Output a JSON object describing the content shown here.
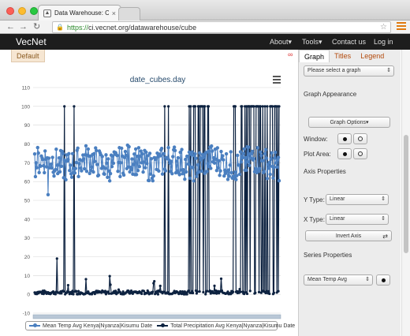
{
  "browser": {
    "tab_title": "Data Warehouse: Cube Br",
    "url_scheme": "https://",
    "url_rest": "ci.vecnet.org/datawarehouse/cube"
  },
  "nav": {
    "brand": "VecNet",
    "links": [
      "About▾",
      "Tools▾",
      "Contact us",
      "Log in"
    ]
  },
  "strip": {
    "default_tab": "Default"
  },
  "chart_data": {
    "type": "line",
    "title": "date_cubes.day",
    "ylim": [
      -10,
      110
    ],
    "yticks": [
      -10,
      0,
      10,
      20,
      30,
      40,
      50,
      60,
      70,
      80,
      90,
      100,
      110
    ],
    "series": [
      {
        "name": "Mean Temp Avg Kenya|Nyanza|Kisumu Date",
        "color": "#4a7fc0",
        "band": [
          63,
          85
        ]
      },
      {
        "name": "Total Precipitation Avg Kenya|Nyanza|Kisumu Date",
        "color": "#0d2240"
      }
    ],
    "grid": true
  },
  "side": {
    "tabs": [
      "Graph",
      "Titles",
      "Legend"
    ],
    "select_graph": "Please select a graph",
    "graph_appearance": "Graph Appearance",
    "graph_options": "Graph Options▾",
    "window_label": "Window:",
    "plot_area_label": "Plot Area:",
    "axis_properties": "Axis Properties",
    "y_type_label": "Y Type:",
    "y_type_value": "Linear",
    "x_type_label": "X Type:",
    "x_type_value": "Linear",
    "invert_axis": "Invert Axis",
    "series_properties": "Series Properties",
    "series_select": "Mean Temp Avg"
  },
  "colors": {
    "nav_bg": "#1d1d1d",
    "accent": "#b34a0c",
    "temp": "#4a7fc0",
    "precip": "#0d2240"
  }
}
